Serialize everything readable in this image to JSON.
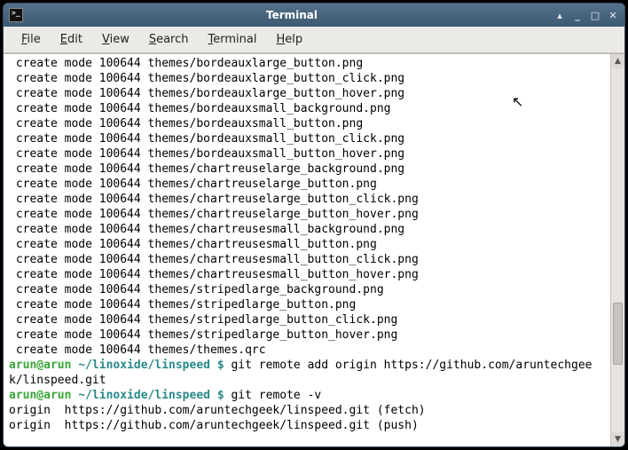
{
  "window": {
    "title": "Terminal",
    "app_icon_glyph": ">_"
  },
  "menubar": {
    "items": [
      {
        "accel": "F",
        "rest": "ile"
      },
      {
        "accel": "E",
        "rest": "dit"
      },
      {
        "accel": "V",
        "rest": "iew"
      },
      {
        "accel": "S",
        "rest": "earch"
      },
      {
        "accel": "T",
        "rest": "erminal"
      },
      {
        "accel": "H",
        "rest": "elp"
      }
    ]
  },
  "term": {
    "create_lines": [
      " create mode 100644 themes/bordeauxlarge_button.png",
      " create mode 100644 themes/bordeauxlarge_button_click.png",
      " create mode 100644 themes/bordeauxlarge_button_hover.png",
      " create mode 100644 themes/bordeauxsmall_background.png",
      " create mode 100644 themes/bordeauxsmall_button.png",
      " create mode 100644 themes/bordeauxsmall_button_click.png",
      " create mode 100644 themes/bordeauxsmall_button_hover.png",
      " create mode 100644 themes/chartreuselarge_background.png",
      " create mode 100644 themes/chartreuselarge_button.png",
      " create mode 100644 themes/chartreuselarge_button_click.png",
      " create mode 100644 themes/chartreuselarge_button_hover.png",
      " create mode 100644 themes/chartreusesmall_background.png",
      " create mode 100644 themes/chartreusesmall_button.png",
      " create mode 100644 themes/chartreusesmall_button_click.png",
      " create mode 100644 themes/chartreusesmall_button_hover.png",
      " create mode 100644 themes/stripedlarge_background.png",
      " create mode 100644 themes/stripedlarge_button.png",
      " create mode 100644 themes/stripedlarge_button_click.png",
      " create mode 100644 themes/stripedlarge_button_hover.png",
      " create mode 100644 themes/themes.qrc"
    ],
    "prompt1_user": "arun@arun ",
    "prompt1_path": "~/linoxide/linspeed $",
    "prompt1_cmd": " git remote add origin https://github.com/aruntechgeek/linspeed.git",
    "prompt2_user": "arun@arun ",
    "prompt2_path": "~/linoxide/linspeed $",
    "prompt2_cmd": " git remote -v",
    "remote_fetch": "origin  https://github.com/aruntechgeek/linspeed.git (fetch)",
    "remote_push": "origin  https://github.com/aruntechgeek/linspeed.git (push)"
  }
}
